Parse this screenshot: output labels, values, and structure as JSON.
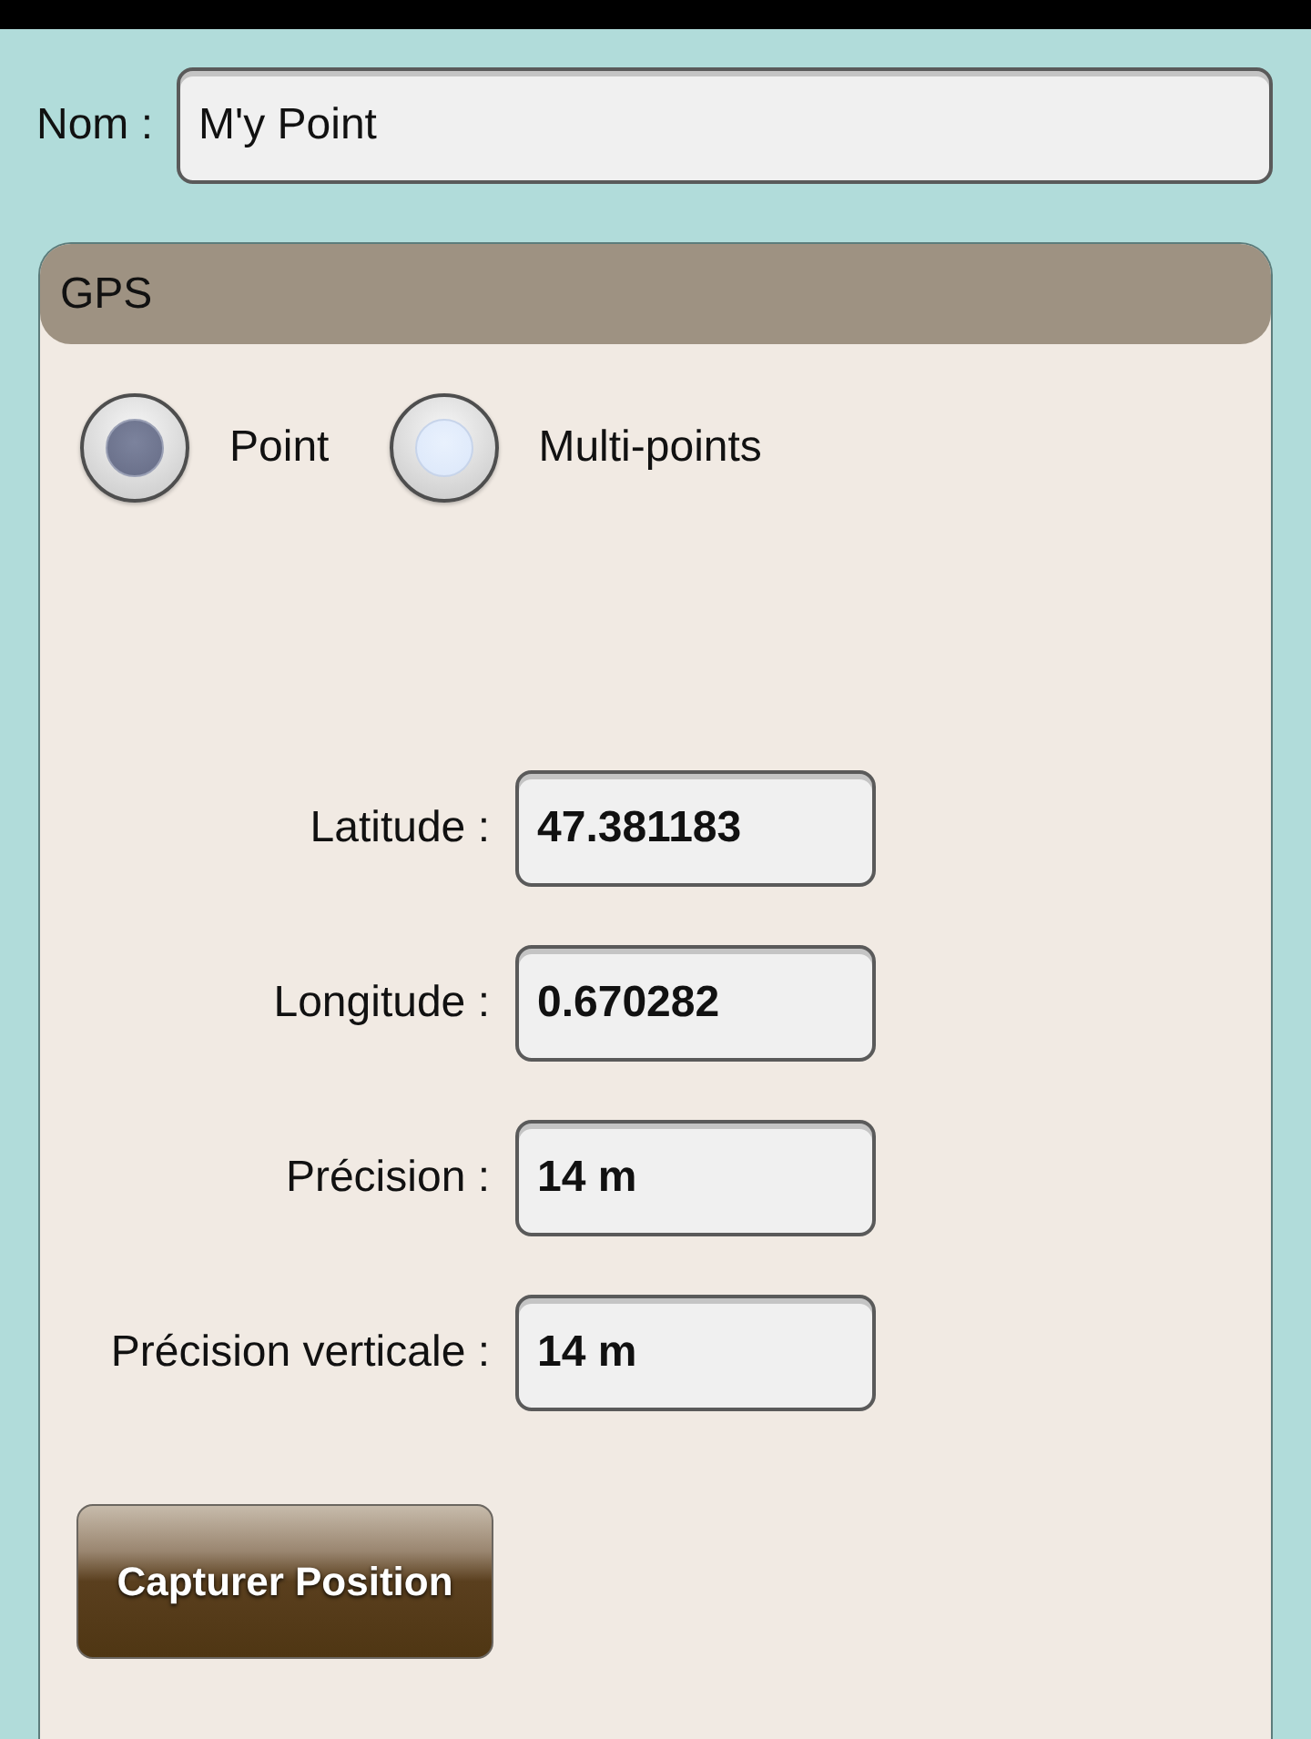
{
  "name_field": {
    "label": "Nom :",
    "value": "M'y Point"
  },
  "gps_panel": {
    "title": "GPS",
    "mode_options": [
      {
        "label": "Point",
        "selected": true
      },
      {
        "label": "Multi-points",
        "selected": false
      }
    ],
    "fields": [
      {
        "label": "Latitude :",
        "value": "47.381183"
      },
      {
        "label": "Longitude :",
        "value": "0.670282"
      },
      {
        "label": "Précision :",
        "value": "14 m"
      },
      {
        "label": "Précision verticale :",
        "value": "14 m"
      }
    ],
    "capture_button": "Capturer Position"
  }
}
